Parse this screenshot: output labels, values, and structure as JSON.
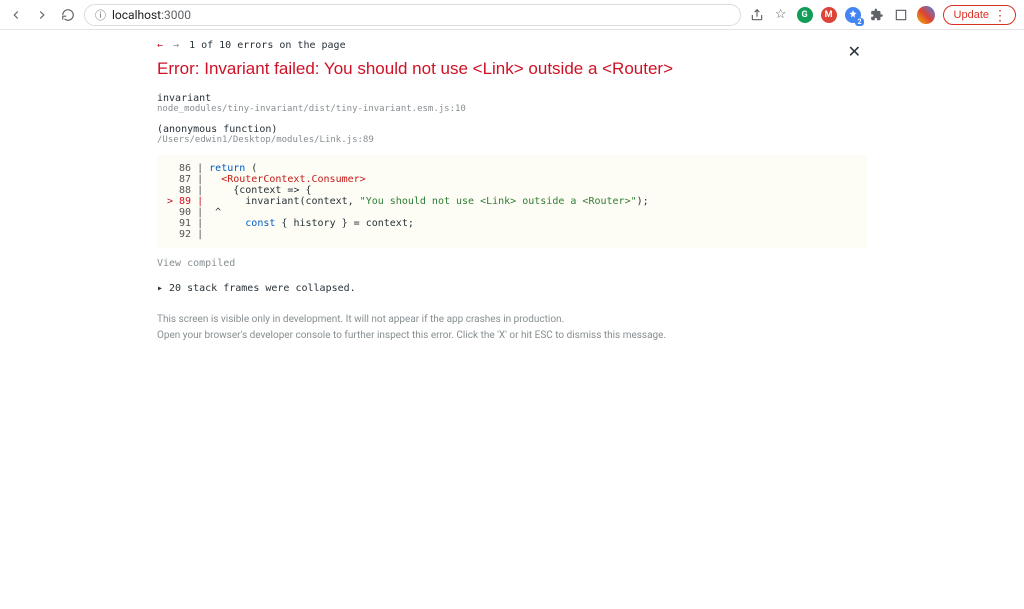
{
  "browser": {
    "url_host": "localhost",
    "url_port": ":3000",
    "update_label": "Update"
  },
  "overlay": {
    "nav_prev": "←",
    "nav_next": "→",
    "nav_text": "1 of 10 errors on the page",
    "close_glyph": "✕",
    "error_title": "Error: Invariant failed: You should not use <Link> outside a <Router>",
    "frame1_label": "invariant",
    "frame1_path": "node_modules/tiny-invariant/dist/tiny-invariant.esm.js:10",
    "frame2_label": "(anonymous function)",
    "frame2_path": "/Users/edwin1/Desktop/modules/Link.js:89",
    "code": {
      "l86_gutter": "  86 | ",
      "l86_kw": "return",
      "l86_rest": " (",
      "l87_gutter": "  87 |   ",
      "l87_tag": "<RouterContext.Consumer>",
      "l88_gutter": "  88 |     ",
      "l88_rest": "{context => {",
      "l89_gutter": "> 89 |       ",
      "l89_call": "invariant(context, ",
      "l89_str": "\"You should not use <Link> outside a <Router>\"",
      "l89_end": ");",
      "l90_gutter": "  90 |  ",
      "l90_rest": "^",
      "l91_gutter": "  91 |       ",
      "l91_kw": "const",
      "l91_rest": " { history } = context;",
      "l92_gutter": "  92 |"
    },
    "view_compiled": "View compiled",
    "collapsed_text": "▸ 20 stack frames were collapsed.",
    "footer_line1": "This screen is visible only in development. It will not appear if the app crashes in production.",
    "footer_line2": "Open your browser's developer console to further inspect this error. Click the 'X' or hit ESC to dismiss this message."
  }
}
